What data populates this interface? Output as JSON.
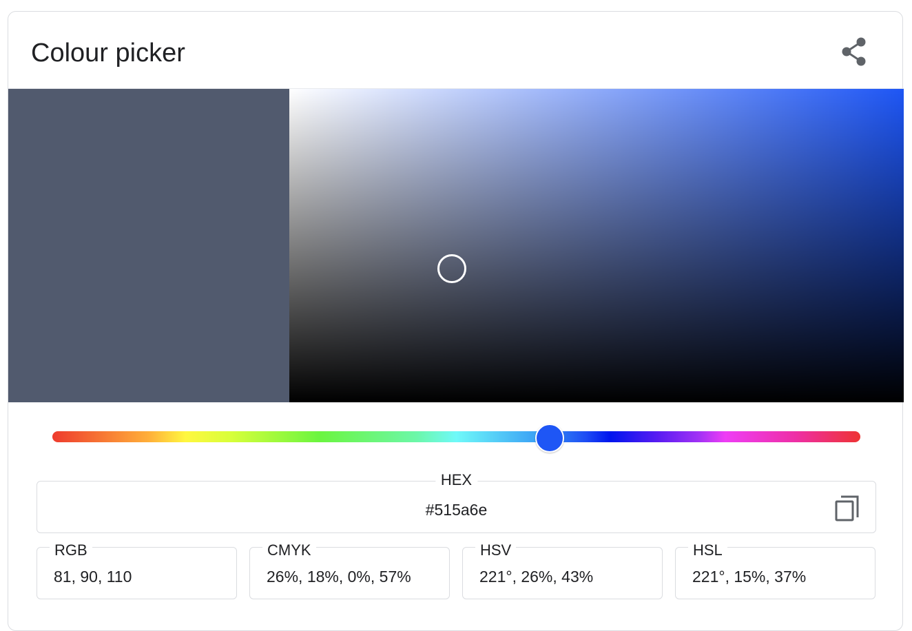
{
  "title": "Colour picker",
  "colors": {
    "selected": "#515a6e",
    "hue_color": "#1e56f5",
    "border": "#dadce0",
    "text": "#202124",
    "icon": "#5f6368"
  },
  "hue_slider": {
    "hue_degrees": 221
  },
  "sv_picker": {
    "saturation_percent": 26,
    "value_percent": 43
  },
  "hex": {
    "label": "HEX",
    "value": "#515a6e"
  },
  "rgb": {
    "label": "RGB",
    "value": "81, 90, 110"
  },
  "cmyk": {
    "label": "CMYK",
    "value": "26%, 18%, 0%, 57%"
  },
  "hsv": {
    "label": "HSV",
    "value": "221°, 26%, 43%"
  },
  "hsl": {
    "label": "HSL",
    "value": "221°, 15%, 37%"
  },
  "icons": {
    "share": "share-icon",
    "copy": "copy-icon"
  }
}
